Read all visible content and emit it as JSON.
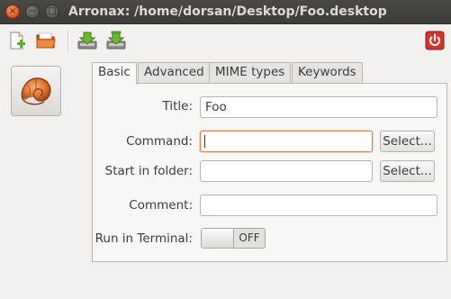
{
  "window": {
    "title": "Arronax: /home/dorsan/Desktop/Foo.desktop"
  },
  "titlebar_buttons": {
    "close": "×",
    "minimize": "−",
    "maximize": "□"
  },
  "toolbar": {
    "icons": [
      "new-file-icon",
      "open-folder-icon",
      "download-icon",
      "save-download-icon",
      "power-icon"
    ]
  },
  "tabs": [
    "Basic",
    "Advanced",
    "MIME types",
    "Keywords"
  ],
  "form": {
    "title": {
      "label": "Title:",
      "value": "Foo"
    },
    "command": {
      "label": "Command:",
      "value": "",
      "button": "Select..."
    },
    "start_in_folder": {
      "label": "Start in folder:",
      "value": "",
      "button": "Select..."
    },
    "comment": {
      "label": "Comment:",
      "value": ""
    },
    "run_in_terminal": {
      "label": "Run in Terminal:",
      "state": "OFF"
    }
  },
  "colors": {
    "focus_border": "#e2793f",
    "titlebar": "#3c3b37",
    "close_button": "#e45a1c",
    "power_red": "#d8322b"
  }
}
